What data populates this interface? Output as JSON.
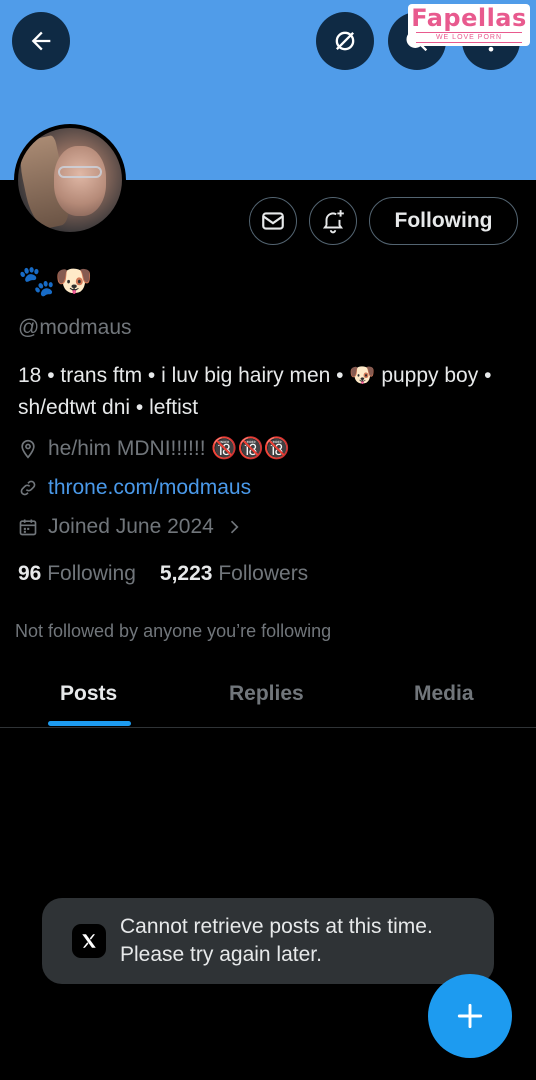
{
  "header": {
    "back_icon": "arrow-left-icon",
    "grok_icon": "grok-icon",
    "search_icon": "search-icon",
    "more_icon": "more-vertical-icon",
    "banner_color": "#509ce9"
  },
  "watermark": {
    "brand": "Fapellas",
    "tagline": "WE LOVE PORN"
  },
  "profile": {
    "display_name": "🐾🐶",
    "handle": "@modmaus",
    "bio": "18 • trans ftm • i luv big hairy men • 🐶 puppy boy • sh/edtwt dni • leftist",
    "location": "he/him MDNI!!!!!! 🔞🔞🔞",
    "website": "throne.com/modmaus",
    "joined": "Joined June 2024",
    "following_count": "96",
    "following_label": "Following",
    "followers_count": "5,223",
    "followers_label": "Followers",
    "not_followed_note": "Not followed by anyone you’re following"
  },
  "actions": {
    "message_icon": "envelope-icon",
    "notify_icon": "bell-plus-icon",
    "following_button": "Following"
  },
  "tabs": [
    {
      "label": "Posts",
      "active": true
    },
    {
      "label": "Replies",
      "active": false
    },
    {
      "label": "Media",
      "active": false
    }
  ],
  "toast": {
    "message": "Cannot retrieve posts at this time. Please try again later."
  },
  "fab": {
    "icon": "plus-icon",
    "color": "#1d9bf0"
  }
}
